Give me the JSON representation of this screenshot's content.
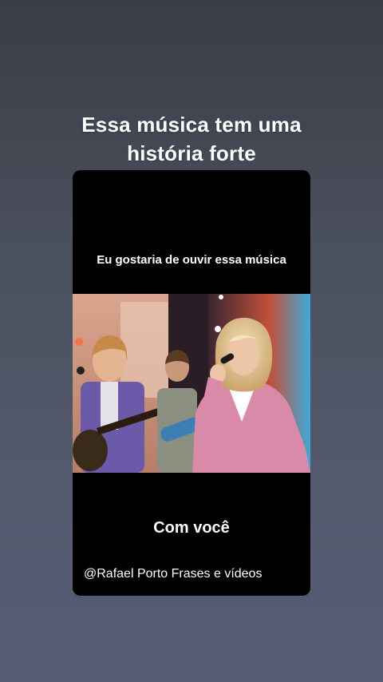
{
  "story": {
    "headline_line1": "Essa música tem uma",
    "headline_line2": "história forte"
  },
  "video": {
    "top_text": "Eu gostaria de ouvir essa música",
    "caption": "Com você",
    "watermark": "@Rafael Porto Frases e vídeos"
  },
  "colors": {
    "background_top": "#3a3d45",
    "background_bottom": "#555c74",
    "card": "#000000",
    "text": "#ffffff",
    "jacket_pink": "#d98aa8",
    "jacket_purple": "#6b5aa8"
  }
}
